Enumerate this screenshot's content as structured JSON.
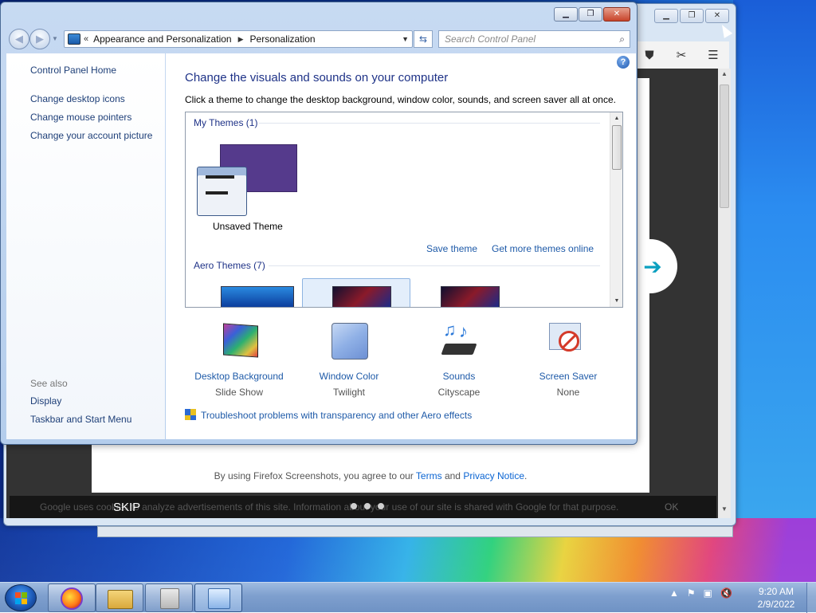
{
  "control_panel": {
    "address": {
      "chevron": "«",
      "crumbs": [
        "Appearance and Personalization",
        "Personalization"
      ],
      "refresh_icon": "refresh-icon"
    },
    "search_placeholder": "Search Control Panel",
    "sidebar": {
      "home": "Control Panel Home",
      "links": [
        "Change desktop icons",
        "Change mouse pointers",
        "Change your account picture"
      ],
      "see_also": "See also",
      "see_also_links": [
        "Display",
        "Taskbar and Start Menu"
      ]
    },
    "main": {
      "help": "?",
      "title": "Change the visuals and sounds on your computer",
      "description": "Click a theme to change the desktop background, window color, sounds, and screen saver all at once.",
      "my_themes": "My Themes (1)",
      "unsaved_theme": "Unsaved Theme",
      "save_theme": "Save theme",
      "get_more": "Get more themes online",
      "aero_themes": "Aero Themes (7)",
      "tiles": [
        {
          "label": "Desktop Background",
          "value": "Slide Show",
          "icon": "desktop-background-icon"
        },
        {
          "label": "Window Color",
          "value": "Twilight",
          "icon": "window-color-icon"
        },
        {
          "label": "Sounds",
          "value": "Cityscape",
          "icon": "sounds-icon"
        },
        {
          "label": "Screen Saver",
          "value": "None",
          "icon": "screen-saver-icon"
        }
      ],
      "troubleshoot": "Troubleshoot problems with transparency and other Aero effects"
    }
  },
  "firefox": {
    "notice_prefix": "By using Firefox Screenshots, you agree to our",
    "terms": "Terms",
    "and": "and",
    "privacy": "Privacy Notice",
    "period": ".",
    "cookie_text": "Google uses cookies to analyze advertisements of this site. Information about your use of our site is shared with Google for that purpose.",
    "ok": "OK",
    "skip": "SKIP"
  },
  "taskbar": {
    "time": "9:20 AM",
    "date": "2/9/2022"
  },
  "colors": {
    "link": "#1e5aa8",
    "title": "#1e3287",
    "theme_purple": "#553a8c"
  }
}
